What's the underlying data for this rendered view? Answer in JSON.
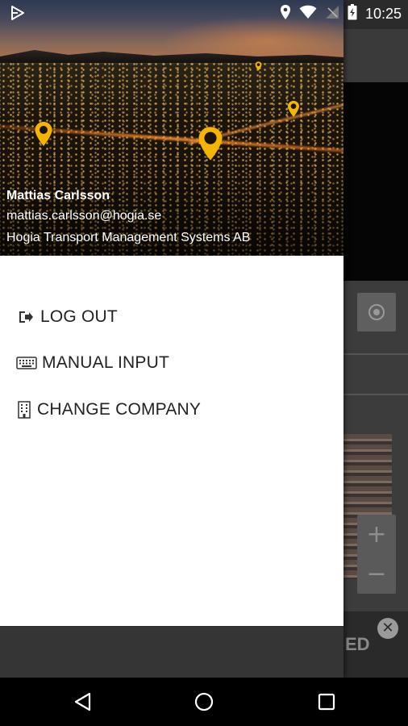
{
  "status_bar": {
    "time": "10:25"
  },
  "drawer": {
    "header": {
      "user_name": "Mattias Carlsson",
      "user_email": "mattias.carlsson@hogia.se",
      "company": "Hogia Transport Management Systems AB"
    },
    "menu": [
      {
        "label": "LOG OUT",
        "icon": "logout-icon"
      },
      {
        "label": "MANUAL INPUT",
        "icon": "keyboard-icon"
      },
      {
        "label": "CHANGE COMPANY",
        "icon": "building-icon"
      }
    ]
  },
  "background_app": {
    "bottom_bar_text": "ED",
    "zoom_in": "+",
    "zoom_out": "−"
  },
  "colors": {
    "pin": "#f4b400",
    "drawer_bg": "#ffffff",
    "menu_text": "#222222"
  }
}
